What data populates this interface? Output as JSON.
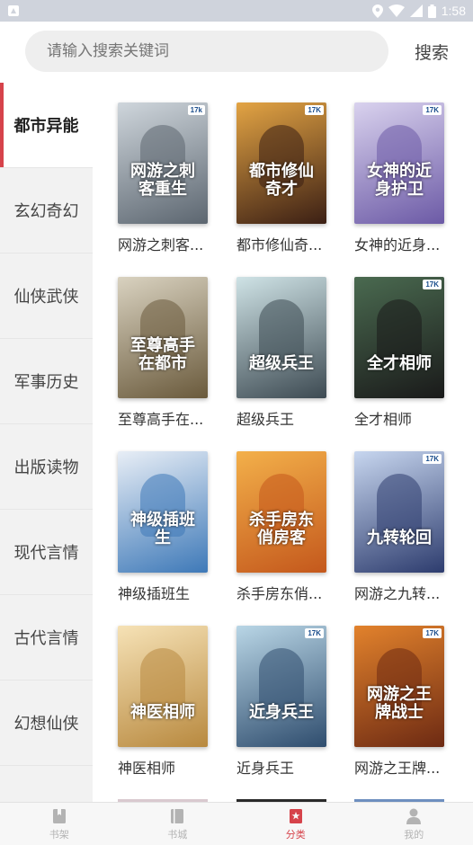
{
  "status_bar": {
    "time": "1:58"
  },
  "search": {
    "placeholder": "请输入搜索关键词",
    "button_label": "搜索"
  },
  "sidebar": {
    "items": [
      {
        "label": "都市异能"
      },
      {
        "label": "玄幻奇幻"
      },
      {
        "label": "仙侠武侠"
      },
      {
        "label": "军事历史"
      },
      {
        "label": "出版读物"
      },
      {
        "label": "现代言情"
      },
      {
        "label": "古代言情"
      },
      {
        "label": "幻想仙侠"
      }
    ]
  },
  "books": [
    {
      "title": "网游之刺客...",
      "cover_text": "网游之刺客重生",
      "badge": "17k",
      "colors": [
        "#5c6670",
        "#cfd6dc"
      ]
    },
    {
      "title": "都市修仙奇...",
      "cover_text": "都市修仙奇才",
      "badge": "17K",
      "colors": [
        "#3b1f14",
        "#e3a444"
      ]
    },
    {
      "title": "女神的近身...",
      "cover_text": "女神的近身护卫",
      "badge": "17K",
      "colors": [
        "#6c5aa6",
        "#d9d2ee"
      ]
    },
    {
      "title": "至尊高手在...",
      "cover_text": "至尊高手在都市",
      "badge": "",
      "colors": [
        "#6a5a3c",
        "#d9d2c0"
      ]
    },
    {
      "title": "超级兵王",
      "cover_text": "超级兵王",
      "badge": "",
      "colors": [
        "#3d4a52",
        "#cfe3e6"
      ]
    },
    {
      "title": "全才相师",
      "cover_text": "全才相师",
      "badge": "17K",
      "colors": [
        "#1a1a1a",
        "#4a6a50"
      ]
    },
    {
      "title": "神级插班生",
      "cover_text": "神级插班生",
      "badge": "",
      "colors": [
        "#3e79b8",
        "#e8eef6"
      ]
    },
    {
      "title": "杀手房东俏...",
      "cover_text": "杀手房东俏房客",
      "badge": "",
      "colors": [
        "#c4581c",
        "#f3b04a"
      ]
    },
    {
      "title": "网游之九转...",
      "cover_text": "九转轮回",
      "badge": "17K",
      "colors": [
        "#2d3c6e",
        "#c7d6ef"
      ]
    },
    {
      "title": "神医相师",
      "cover_text": "神医相师",
      "badge": "",
      "colors": [
        "#b8893f",
        "#f6e2b6"
      ]
    },
    {
      "title": "近身兵王",
      "cover_text": "近身兵王",
      "badge": "17K",
      "colors": [
        "#2f4d6e",
        "#b9d6e6"
      ]
    },
    {
      "title": "网游之王牌...",
      "cover_text": "网游之王牌战士",
      "badge": "17K",
      "colors": [
        "#6d2a13",
        "#e2822c"
      ]
    }
  ],
  "tabs": [
    {
      "label": "书架",
      "icon": "bookmark-icon"
    },
    {
      "label": "书城",
      "icon": "book-icon"
    },
    {
      "label": "分类",
      "icon": "category-icon"
    },
    {
      "label": "我的",
      "icon": "user-icon"
    }
  ],
  "colors": {
    "accent": "#d6434b",
    "sidebar_bg": "#f2f2f2",
    "status_bar": "#cfd3dc"
  }
}
